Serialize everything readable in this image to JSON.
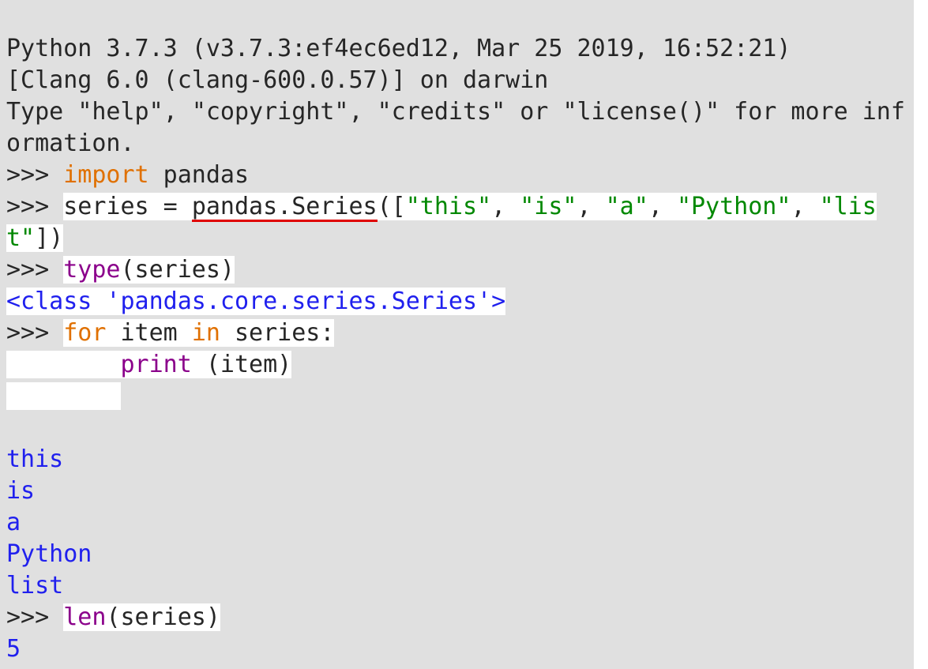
{
  "banner": {
    "line1": "Python 3.7.3 (v3.7.3:ef4ec6ed12, Mar 25 2019, 16:52:21) ",
    "line2": "[Clang 6.0 (clang-600.0.57)] on darwin",
    "line3a": "Type ",
    "q1": "\"help\"",
    "sep1": ", ",
    "q2": "\"copyright\"",
    "sep2": ", ",
    "q3": "\"credits\"",
    "sep3": " or ",
    "q4": "\"license()\"",
    "line3b": " for more information."
  },
  "prompt": ">>> ",
  "cont": "        ",
  "line_import": {
    "kw": "import",
    "rest": " pandas"
  },
  "line_series": {
    "lhs": "series = ",
    "call": "pandas.Series",
    "open": "([",
    "s1": "\"this\"",
    "c1": ", ",
    "s2": "\"is\"",
    "c2": ", ",
    "s3": "\"a\"",
    "c3": ", ",
    "s4": "\"Python\"",
    "c4": ", ",
    "s5": "\"list\"",
    "close": "])"
  },
  "line_type": {
    "fn": "type",
    "args": "(series)"
  },
  "output_type": "<class 'pandas.core.series.Series'>",
  "line_for": {
    "kw_for": "for",
    "sp1": " item ",
    "kw_in": "in",
    "rest": " series:"
  },
  "line_print": {
    "indent": "        ",
    "fn": "print",
    "sp": " ",
    "args": "(item)"
  },
  "blank": "",
  "loop_output": [
    "this",
    "is",
    "a",
    "Python",
    "list"
  ],
  "line_len": {
    "fn": "len",
    "args": "(series)"
  },
  "output_len": "5"
}
